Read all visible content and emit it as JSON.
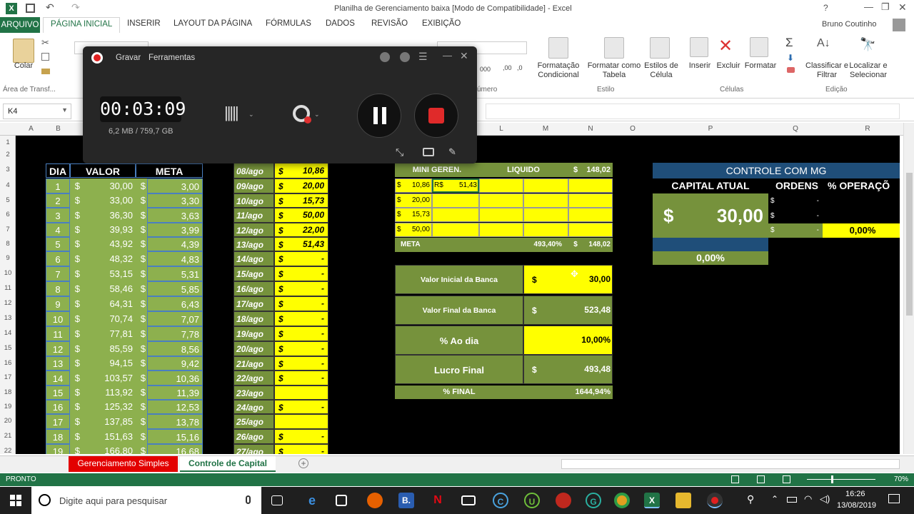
{
  "window": {
    "title": "Planilha de Gerenciamento  baixa  [Modo de Compatibilidade] - Excel",
    "user": "Bruno Coutinho"
  },
  "ribbon_tabs": [
    "ARQUIVO",
    "PÁGINA INICIAL",
    "INSERIR",
    "LAYOUT DA PÁGINA",
    "FÓRMULAS",
    "DADOS",
    "REVISÃO",
    "EXIBIÇÃO"
  ],
  "ribbon": {
    "paste": "Colar",
    "clipboard_group": "Área de Transf...",
    "number_group": "úmero",
    "number_fmt": "000",
    "cond_format": "Formatação Condicional",
    "format_table": "Formatar como Tabela",
    "cell_styles": "Estilos de Célula",
    "styles_group": "Estilo",
    "insert": "Inserir",
    "delete": "Excluir",
    "format": "Formatar",
    "cells_group": "Células",
    "sort": "Classificar e Filtrar",
    "find": "Localizar e Selecionar",
    "edit_group": "Edição"
  },
  "namebox": "K4",
  "columns": [
    "A",
    "B",
    "",
    "",
    "",
    "",
    "",
    "",
    "",
    "",
    "L",
    "M",
    "N",
    "O",
    "P",
    "Q",
    "R"
  ],
  "rows": [
    "1",
    "2",
    "3",
    "4",
    "5",
    "6",
    "7",
    "8",
    "9",
    "10",
    "11",
    "12",
    "13",
    "14",
    "15",
    "16",
    "17",
    "18",
    "19",
    "20",
    "21",
    "22"
  ],
  "left_table": {
    "headers": [
      "DIA",
      "VALOR",
      "META"
    ],
    "currency": "$",
    "rows": [
      [
        "1",
        "30,00",
        "3,00"
      ],
      [
        "2",
        "33,00",
        "3,30"
      ],
      [
        "3",
        "36,30",
        "3,63"
      ],
      [
        "4",
        "39,93",
        "3,99"
      ],
      [
        "5",
        "43,92",
        "4,39"
      ],
      [
        "6",
        "48,32",
        "4,83"
      ],
      [
        "7",
        "53,15",
        "5,31"
      ],
      [
        "8",
        "58,46",
        "5,85"
      ],
      [
        "9",
        "64,31",
        "6,43"
      ],
      [
        "10",
        "70,74",
        "7,07"
      ],
      [
        "11",
        "77,81",
        "7,78"
      ],
      [
        "12",
        "85,59",
        "8,56"
      ],
      [
        "13",
        "94,15",
        "9,42"
      ],
      [
        "14",
        "103,57",
        "10,36"
      ],
      [
        "15",
        "113,92",
        "11,39"
      ],
      [
        "16",
        "125,32",
        "12,53"
      ],
      [
        "17",
        "137,85",
        "13,78"
      ],
      [
        "18",
        "151,63",
        "15,16"
      ],
      [
        "19",
        "166,80",
        "16,68"
      ]
    ]
  },
  "date_table": {
    "currency": "$",
    "rows": [
      [
        "08/ago",
        "$",
        "10,86"
      ],
      [
        "09/ago",
        "$",
        "20,00"
      ],
      [
        "10/ago",
        "$",
        "15,73"
      ],
      [
        "11/ago",
        "$",
        "50,00"
      ],
      [
        "12/ago",
        "$",
        "22,00"
      ],
      [
        "13/ago",
        "$",
        "51,43"
      ],
      [
        "14/ago",
        "$",
        "-"
      ],
      [
        "15/ago",
        "$",
        "-"
      ],
      [
        "16/ago",
        "$",
        "-"
      ],
      [
        "17/ago",
        "$",
        "-"
      ],
      [
        "18/ago",
        "$",
        "-"
      ],
      [
        "19/ago",
        "$",
        "-"
      ],
      [
        "20/ago",
        "$",
        "-"
      ],
      [
        "21/ago",
        "$",
        "-"
      ],
      [
        "22/ago",
        "$",
        "-"
      ],
      [
        "23/ago",
        "",
        ""
      ],
      [
        "24/ago",
        "$",
        "-"
      ],
      [
        "25/ago",
        "",
        ""
      ],
      [
        "26/ago",
        "$",
        "-"
      ],
      [
        "27/ago",
        "$",
        "-"
      ]
    ]
  },
  "mini": {
    "header": "MINI GEREN.",
    "liquido": "LIQUIDO",
    "liq_cur": "$",
    "liq_val": "148,02",
    "rows": [
      [
        "$",
        "10,86",
        "R$",
        "51,43"
      ],
      [
        "$",
        "20,00",
        "",
        ""
      ],
      [
        "$",
        "15,73",
        "",
        ""
      ],
      [
        "$",
        "50,00",
        "",
        ""
      ]
    ],
    "meta": "META",
    "meta_pct": "493,40%",
    "meta_cur": "$",
    "meta_val": "148,02"
  },
  "summary": [
    [
      "Valor Inicial da Banca",
      "$",
      "30,00"
    ],
    [
      "Valor Final da Banca",
      "$",
      "523,48"
    ],
    [
      "% Ao dia",
      "",
      "10,00%"
    ],
    [
      "Lucro Final",
      "$",
      "493,48"
    ]
  ],
  "final": {
    "label": "% FINAL",
    "value": "1644,94%"
  },
  "controle": {
    "title": "CONTROLE COM MG",
    "capital_label": "CAPITAL ATUAL",
    "ordens": "ORDENS",
    "operacao": "% OPERAÇÕ",
    "cap_cur": "$",
    "cap_val": "30,00",
    "o1": "$",
    "d1": "-",
    "o2": "$",
    "d2": "-",
    "o3": "$",
    "d3": "-",
    "op_pct": "0,00%",
    "bottom_pct": "0,00%"
  },
  "recorder": {
    "menu1": "Gravar",
    "menu2": "Ferramentas",
    "time": "00:03:09",
    "size": "6,2 MB / 759,7 GB"
  },
  "sheet_tabs": [
    "Gerenciamento Simples",
    "Controle de Capital"
  ],
  "status": {
    "ready": "PRONTO",
    "zoom": "70%"
  },
  "taskbar": {
    "search": "Digite aqui para pesquisar",
    "time": "16:26",
    "date": "13/08/2019"
  }
}
